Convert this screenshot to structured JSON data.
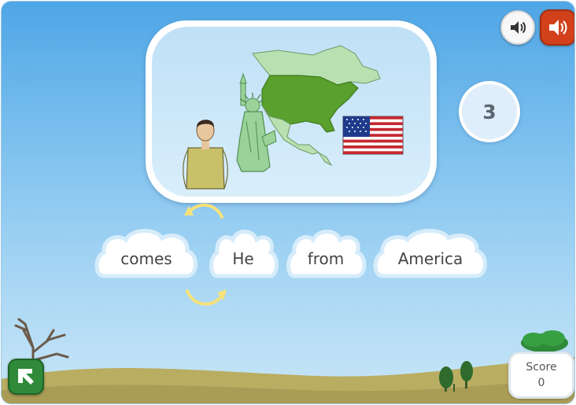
{
  "counter": "3",
  "words": [
    {
      "label": "comes"
    },
    {
      "label": "He"
    },
    {
      "label": "from"
    },
    {
      "label": "America"
    }
  ],
  "score": {
    "label": "Score",
    "value": "0"
  },
  "icons": {
    "sound_light": "speaker-icon",
    "sound_dark": "speaker-loud-icon",
    "exit": "exit-arrow-icon",
    "swap_top": "curved-arrow-left-icon",
    "swap_bottom": "curved-arrow-right-icon"
  },
  "colors": {
    "sky": "#7cc0ee",
    "map_usa": "#5aa02c",
    "map_other": "#b8e0b0",
    "exit_button": "#2f8a3a",
    "sound_on_button": "#d2401c",
    "arrow": "#f6e27a"
  }
}
